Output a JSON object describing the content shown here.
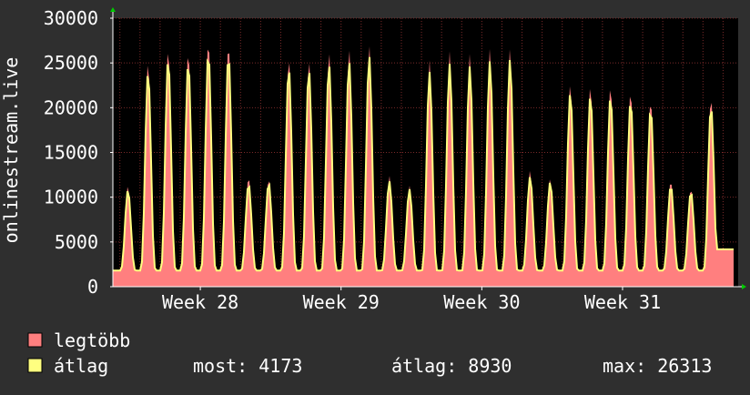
{
  "colors": {
    "background": "#2f2f2f",
    "plot_background": "#000000",
    "grid": "#7a2a2a",
    "axis": "#ffffff",
    "legtobb": "#ff7f7f",
    "atlag": "#ffff80",
    "arrow": "#00cc00"
  },
  "chart_data": {
    "type": "area",
    "ylabel": "onlinestream.live",
    "ylim": [
      0,
      30000
    ],
    "y_ticks": [
      0,
      5000,
      10000,
      15000,
      20000,
      25000,
      30000
    ],
    "y_tick_labels": [
      "0",
      "5000",
      "10000",
      "15000",
      "20000",
      "25000",
      "30000"
    ],
    "x_labels": [
      "Week 28",
      "Week 29",
      "Week 30",
      "Week 31"
    ],
    "grid": true,
    "legend_position": "bottom-left",
    "series": [
      {
        "name": "legtöbb",
        "color": "#ff7f7f",
        "style": "area",
        "daily_peaks": [
          11300,
          25200,
          26700,
          26400,
          27600,
          27300,
          12300,
          12100,
          25600,
          25400,
          26300,
          26600,
          27000,
          12400,
          11300,
          25300,
          26300,
          26000,
          26600,
          26600,
          13000,
          12100,
          22700,
          22500,
          22500,
          21900,
          20900,
          11900,
          11000,
          21200
        ]
      },
      {
        "name": "átlag",
        "color": "#ffff80",
        "style": "line",
        "daily_peaks": [
          10800,
          24000,
          25500,
          25100,
          26200,
          26000,
          11500,
          11600,
          24500,
          24300,
          24900,
          25200,
          25800,
          11800,
          10900,
          24000,
          24900,
          24600,
          25200,
          25400,
          12300,
          11700,
          21700,
          21400,
          21300,
          20800,
          19900,
          11300,
          10600,
          20200
        ]
      }
    ],
    "daily_min": 1800,
    "last_value": 4173
  },
  "legend": [
    {
      "label": "legtöbb",
      "color": "#ff7f7f"
    },
    {
      "label": "átlag",
      "color": "#ffff80"
    }
  ],
  "stats": {
    "most": "most: 4173",
    "atlag": "átlag: 8930",
    "max": "max: 26313"
  }
}
